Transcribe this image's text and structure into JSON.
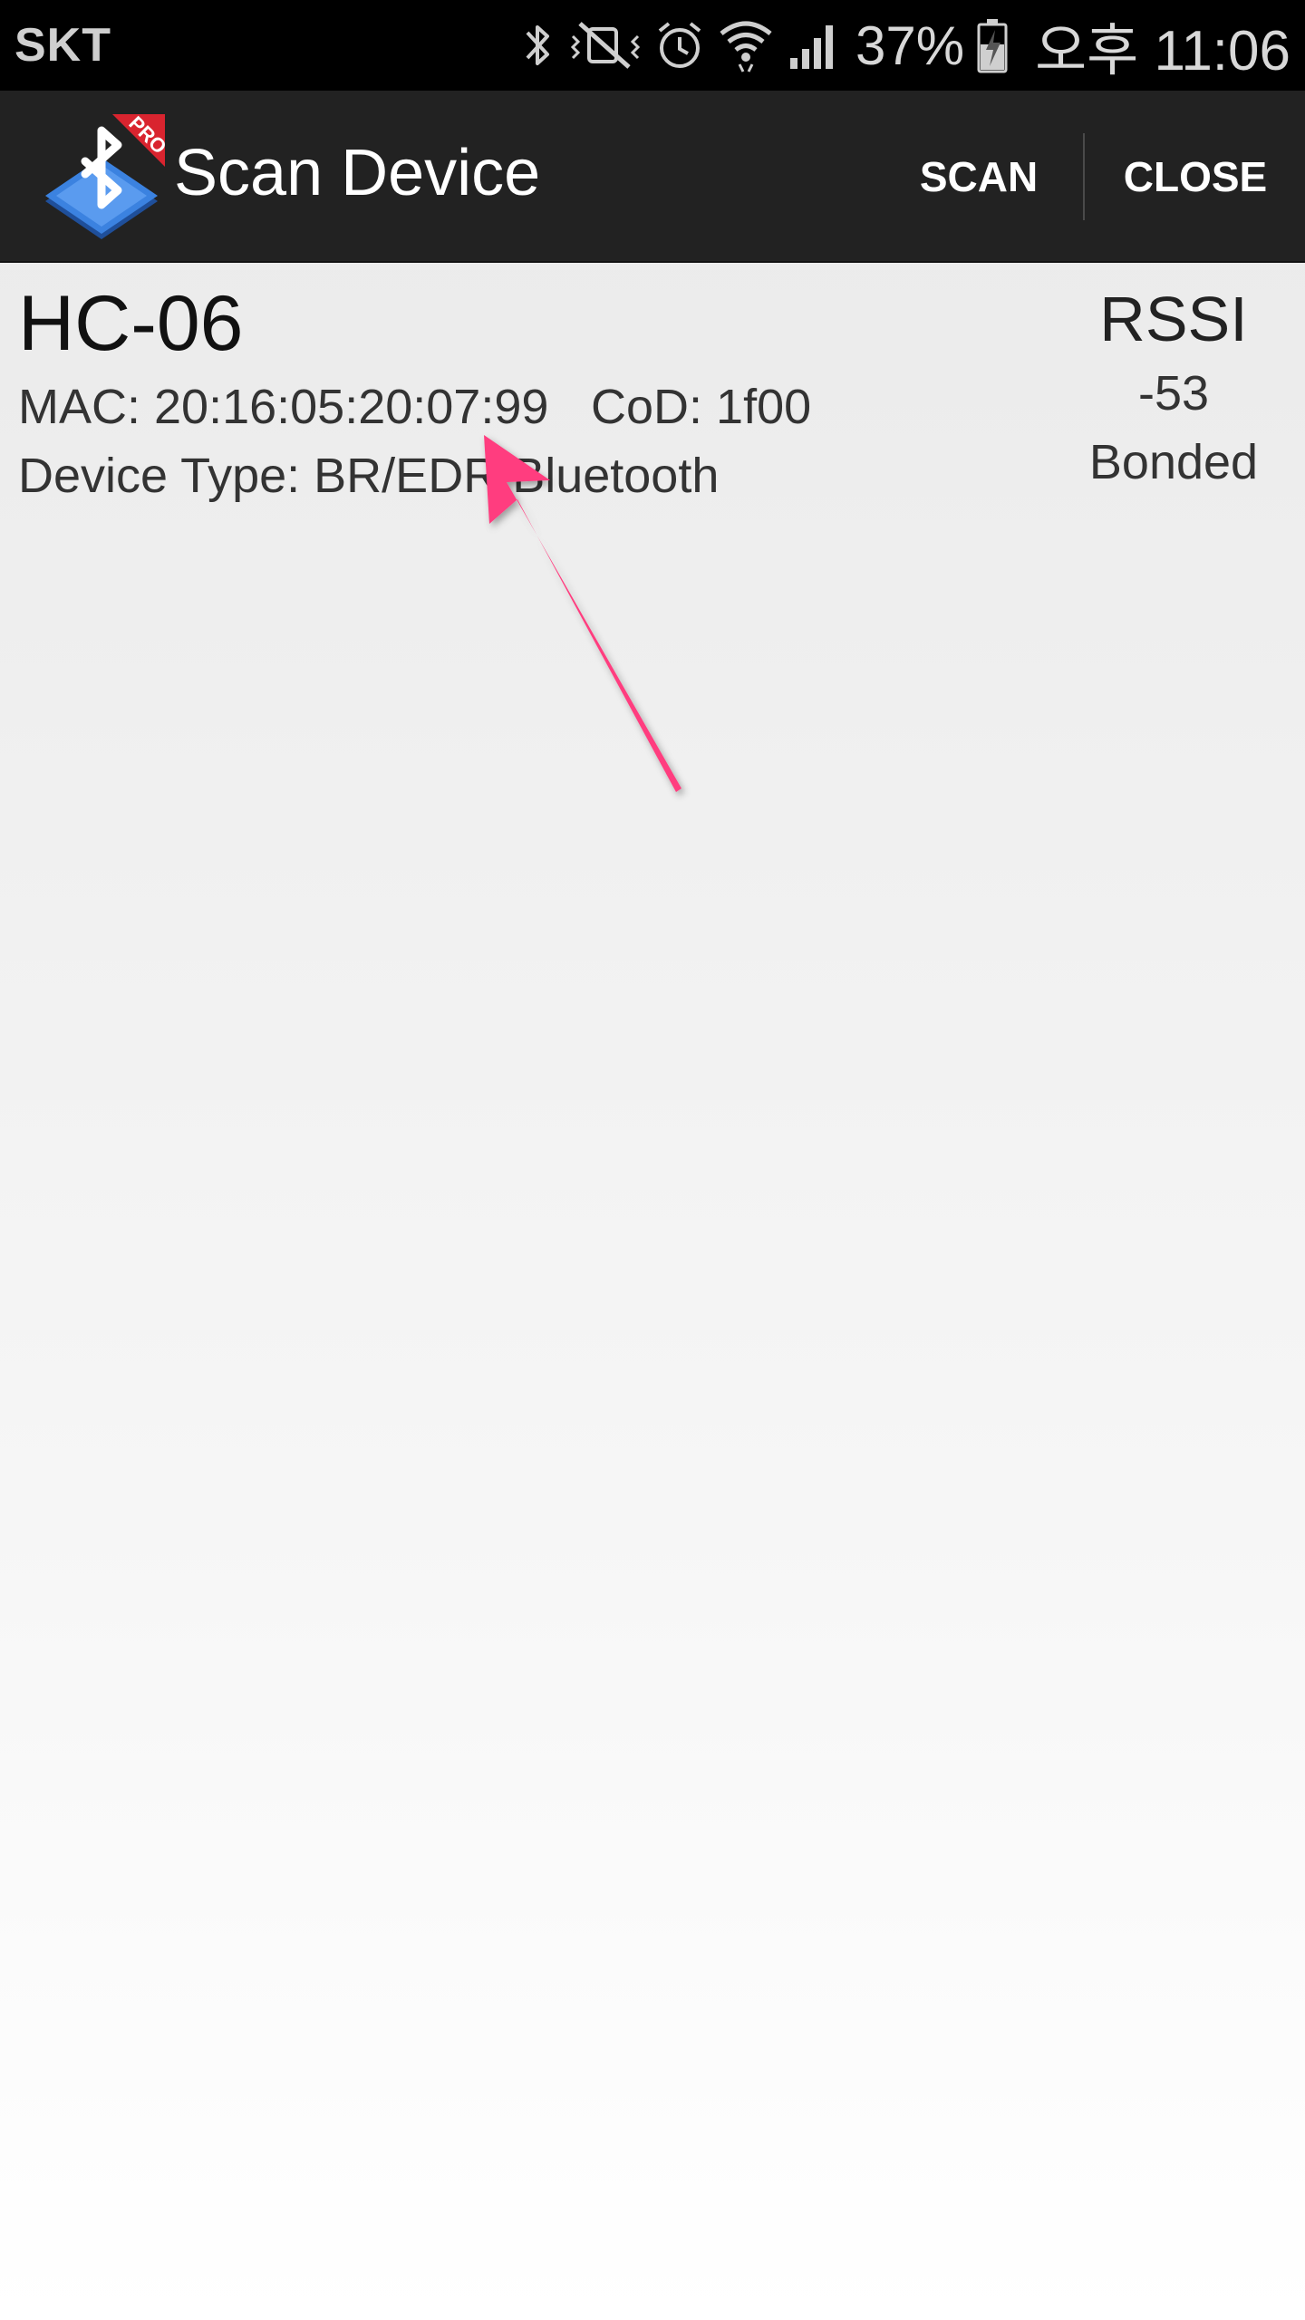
{
  "status_bar": {
    "carrier": "SKT",
    "icons": [
      "bluetooth-icon",
      "vibrate-mute-icon",
      "alarm-icon",
      "wifi-icon",
      "signal-icon",
      "battery-charging-icon"
    ],
    "battery_percent": "37%",
    "time": "오후 11:06"
  },
  "action_bar": {
    "logo_badge": "PRO",
    "title": "Scan Device",
    "scan_label": "SCAN",
    "close_label": "CLOSE"
  },
  "devices": [
    {
      "name": "HC-06",
      "mac": "MAC: 20:16:05:20:07:99",
      "cod": "CoD: 1f00",
      "device_type": "Device Type: BR/EDR Bluetooth",
      "rssi_label": "RSSI",
      "rssi_value": "-53",
      "bond_state": "Bonded"
    }
  ],
  "colors": {
    "status_bar_bg": "#000000",
    "action_bar_bg": "#222222",
    "annotation_arrow": "#ff3d7f",
    "logo_blue": "#2f6fd0",
    "logo_badge_red": "#d9242f"
  }
}
